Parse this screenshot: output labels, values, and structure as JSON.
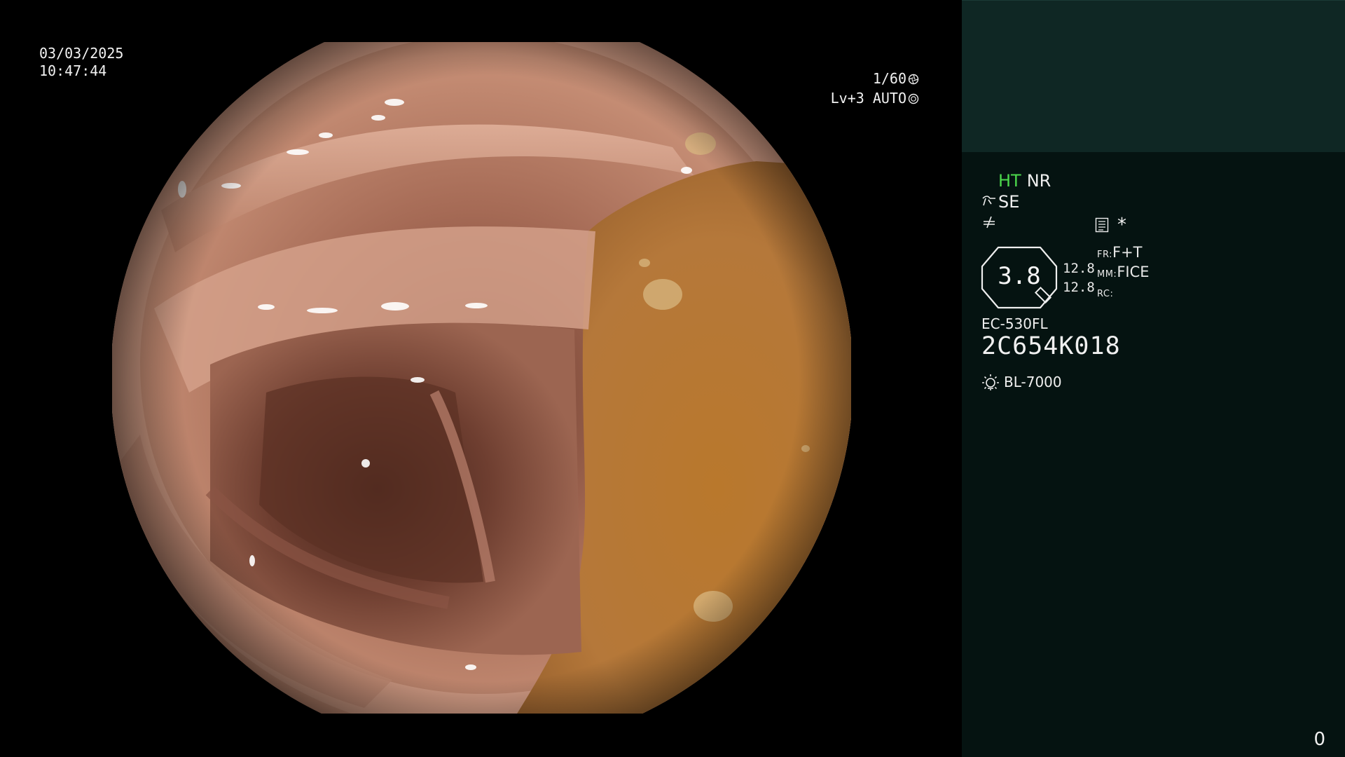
{
  "overlay": {
    "date": "03/03/2025",
    "time": "10:47:44",
    "shutter": "1/60",
    "shutter_icon": "shutter-icon",
    "level": "Lv+3 AUTO",
    "auto_iris_icon": "iris-icon"
  },
  "panel": {
    "mode_ht": "HT",
    "mode_nr": "NR",
    "structure_enhance": "SE",
    "structure_icon": "structure-enhance-icon",
    "sharpness_icon": "sharpness-icon",
    "doc_icon": "document-settings-icon",
    "star": "*",
    "zoom": "3.8",
    "zoom_value_1": "12.8",
    "zoom_value_2": "12.8",
    "fr_key": "FR:",
    "fr_value": "F+T",
    "mm_key": "MM:",
    "mm_value": "FICE",
    "rc_key": "RC:",
    "scope_model": "EC-530FL",
    "scope_serial": "2C654K018",
    "light_icon": "light-source-icon",
    "light_source": "BL-7000",
    "frame_counter": "0"
  },
  "colors": {
    "panel_bg": "#051311",
    "panel_header_bg": "#0f2724",
    "ht_green": "#4cd84c",
    "mucosa_pink": "#c98d73",
    "fluid_amber": "#b77a32"
  }
}
